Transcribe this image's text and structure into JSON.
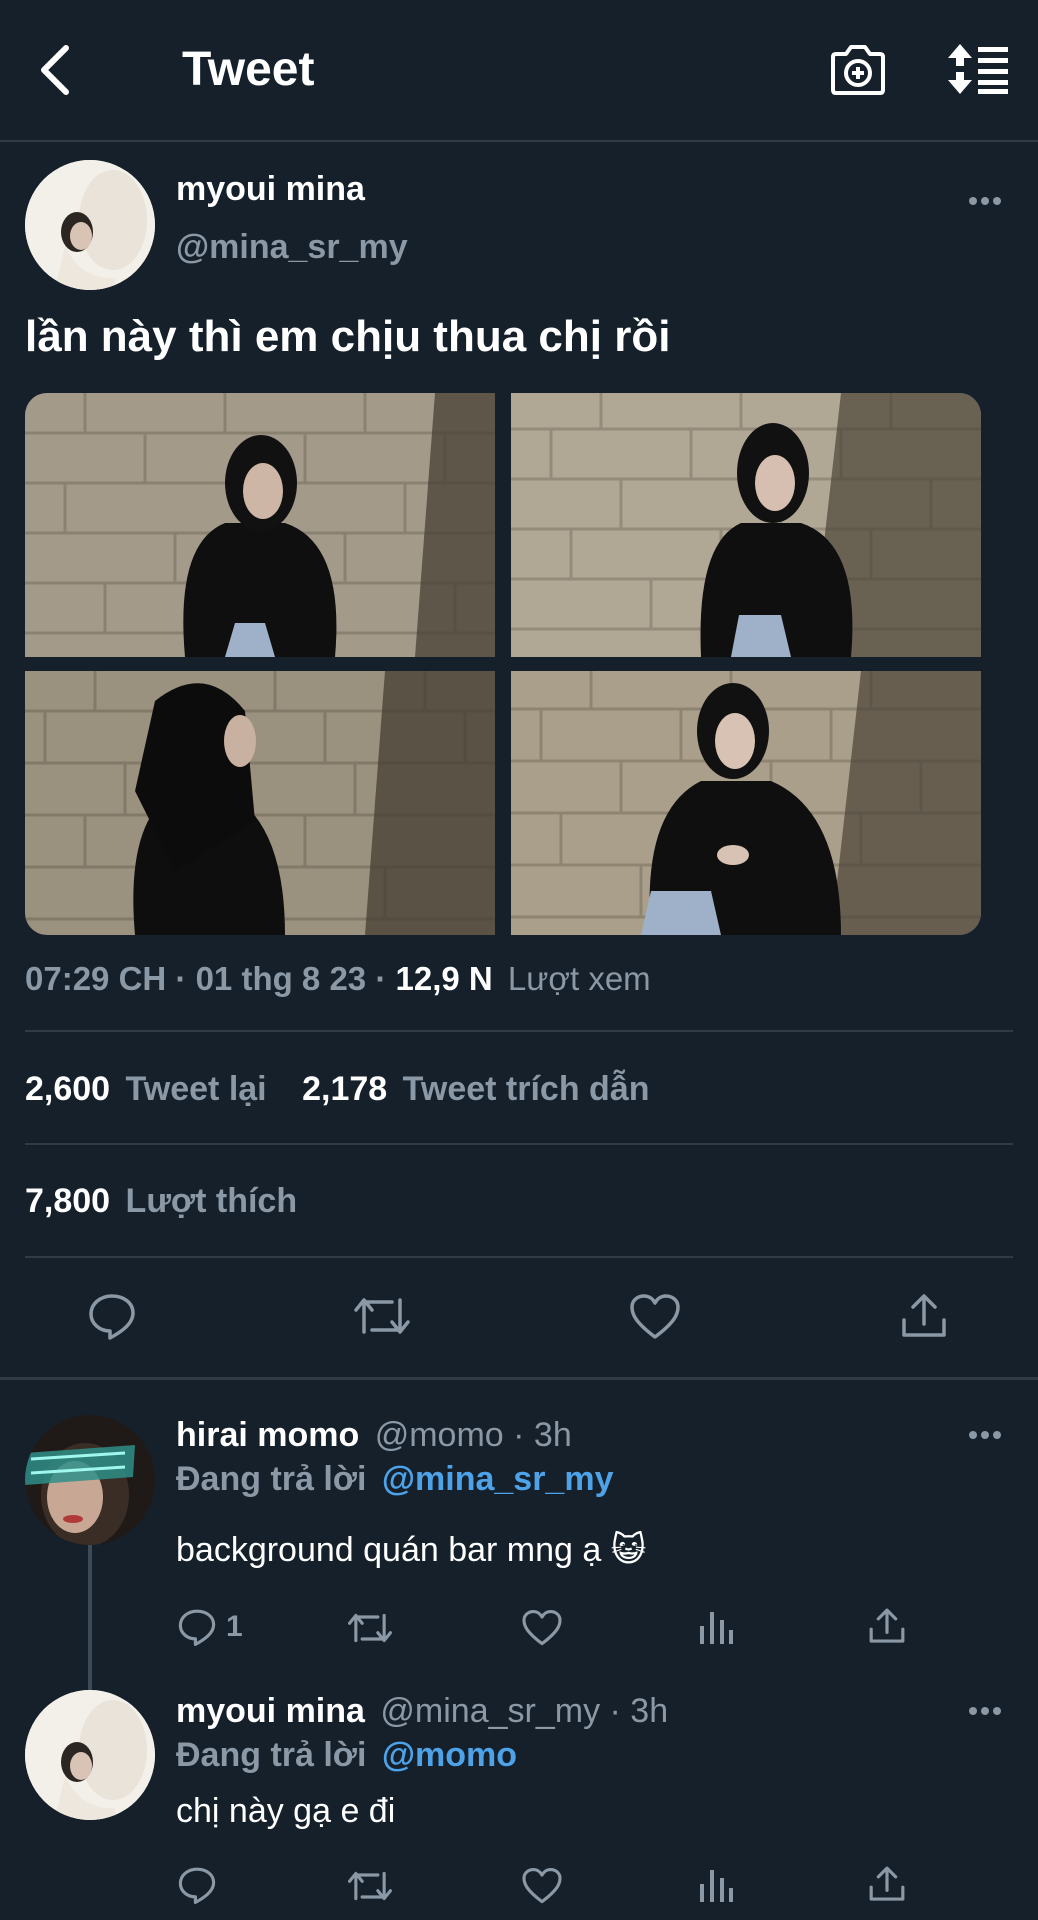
{
  "header": {
    "title": "Tweet",
    "icons": [
      "back-arrow-icon",
      "camera-add-icon",
      "sort-timeline-icon"
    ]
  },
  "tweet": {
    "display_name": "myoui mina",
    "handle": "@mina_sr_my",
    "text": "lần này thì em chịu thua chị rồi",
    "time": "07:29 CH",
    "date": "01 thg 8 23",
    "views_count": "12,9 N",
    "views_label": "Lượt xem",
    "retweets_count": "2,600",
    "retweets_label": "Tweet lại",
    "quotes_count": "2,178",
    "quotes_label": "Tweet trích dẫn",
    "likes_count": "7,800",
    "likes_label": "Lượt thích",
    "sep": "·"
  },
  "replies": [
    {
      "display_name": "hirai momo",
      "handle": "@momo",
      "age": "3h",
      "replying_label": "Đang trả lời",
      "replying_to": "@mina_sr_my",
      "text": "background quán bar mng ạ 😺",
      "reply_count": "1"
    },
    {
      "display_name": "myoui mina",
      "handle": "@mina_sr_my",
      "age": "3h",
      "replying_label": "Đang trả lời",
      "replying_to": "@momo",
      "text": "chị này gạ e đi",
      "reply_count": ""
    }
  ],
  "colors": {
    "background": "#15202b",
    "muted": "#8b98a5",
    "link": "#4ea3e8",
    "divider": "#2f3b47"
  }
}
